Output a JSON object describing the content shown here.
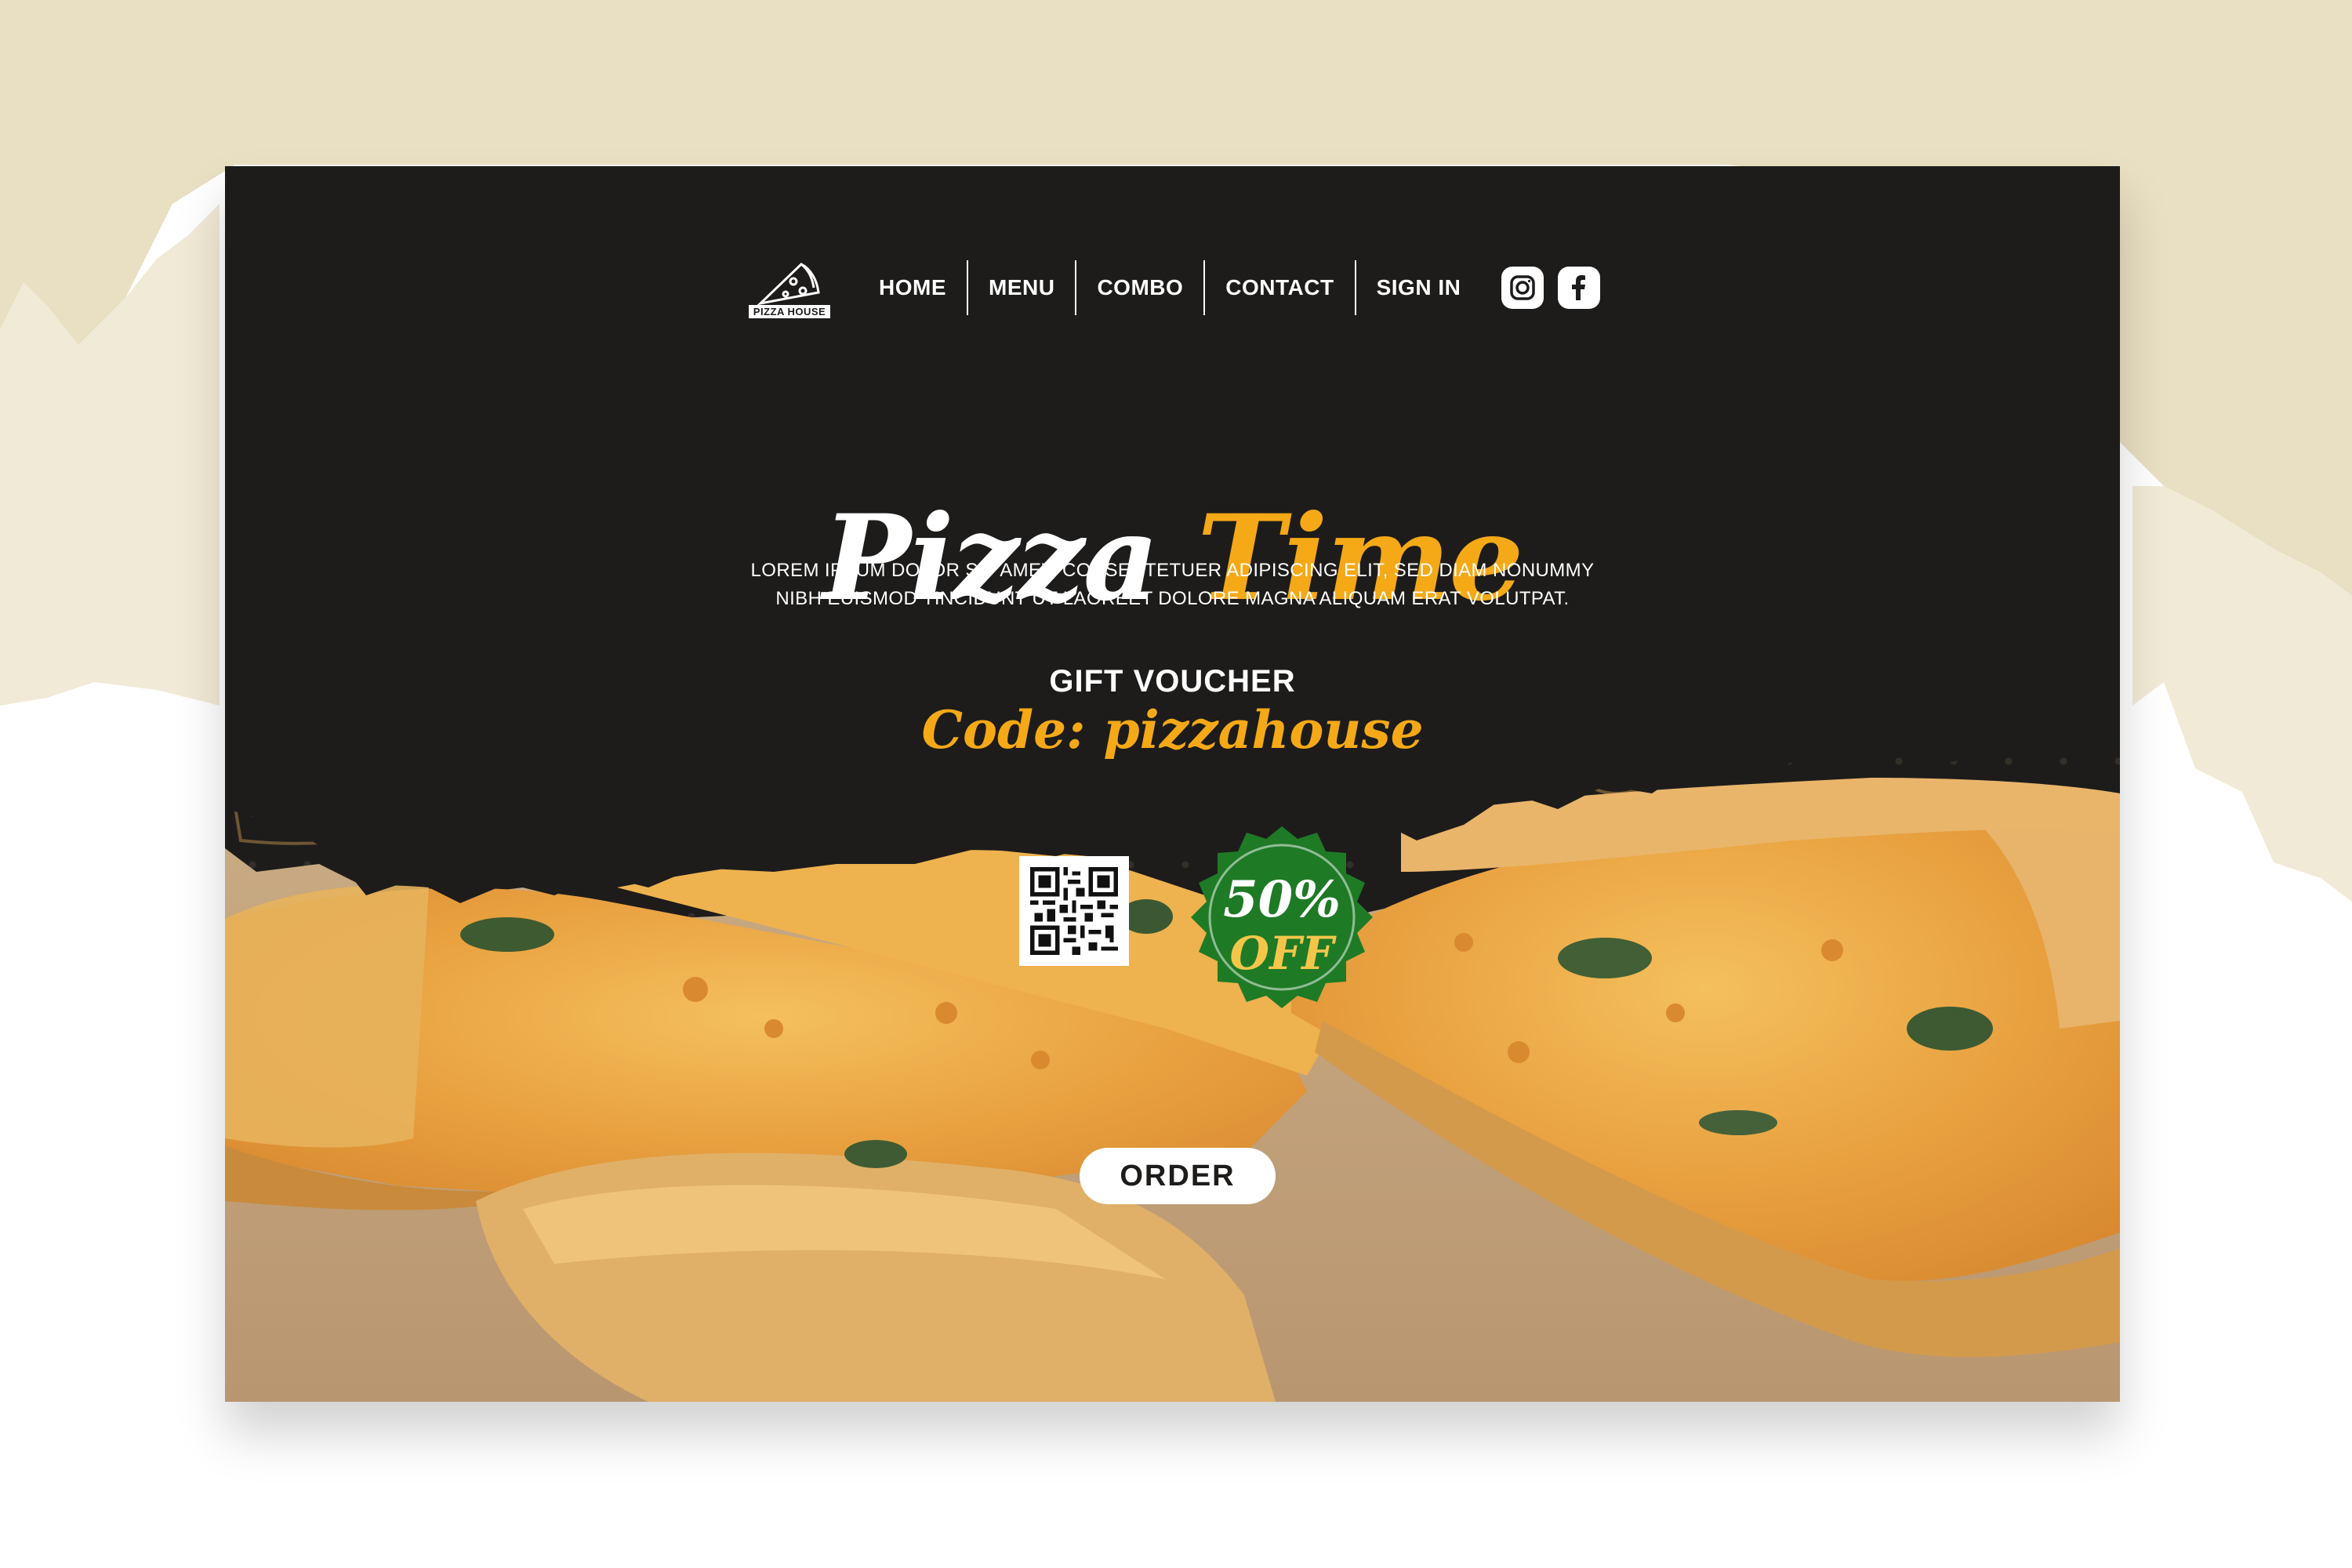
{
  "colors": {
    "page_dark": "#1d1c1b",
    "accent_orange": "#f5a916",
    "badge_green": "#1f7a26",
    "doodle_brown": "#6e5634",
    "backdrop_beige": "#e9dfc2"
  },
  "logo": {
    "text": "PIZZA HOUSE",
    "icon": "pizza-slice-icon"
  },
  "nav": {
    "items": [
      "HOME",
      "MENU",
      "COMBO",
      "CONTACT",
      "SIGN IN"
    ]
  },
  "social": {
    "icons": [
      "instagram-icon",
      "facebook-icon"
    ]
  },
  "hero": {
    "title_part1": "Pizza",
    "title_part2": "Time",
    "description_line1": "LOREM IPSUM DOLOR SIT AMET, CONSECTETUER ADIPISCING ELIT, SED DIAM NONUMMY",
    "description_line2": "NIBH EUISMOD TINCIDUNT UT LAOREET DOLORE MAGNA ALIQUAM ERAT VOLUTPAT."
  },
  "voucher": {
    "label": "GIFT VOUCHER",
    "code": "Code: pizzahouse"
  },
  "badge": {
    "percent": "50%",
    "off": "OFF"
  },
  "qr": {
    "icon": "qr-code-icon"
  },
  "order": {
    "label": "ORDER"
  }
}
